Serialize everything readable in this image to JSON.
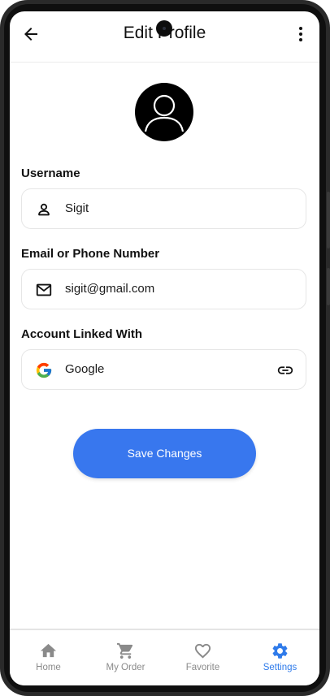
{
  "appbar": {
    "title": "Edit Profile",
    "back_icon": "arrow-back-icon",
    "more_icon": "more-vert-icon"
  },
  "avatar": {
    "icon": "person-icon"
  },
  "form": {
    "username": {
      "label": "Username",
      "value": "Sigit",
      "icon": "person-outline-icon"
    },
    "contact": {
      "label": "Email or Phone Number",
      "value": "sigit@gmail.com",
      "icon": "mail-outline-icon"
    },
    "linked": {
      "label": "Account Linked With",
      "value": "Google",
      "icon": "google-icon",
      "action_icon": "link-icon"
    }
  },
  "save_button": {
    "label": "Save Changes"
  },
  "bottom_nav": {
    "items": [
      {
        "label": "Home",
        "icon": "home-icon",
        "active": false
      },
      {
        "label": "My Order",
        "icon": "cart-icon",
        "active": false
      },
      {
        "label": "Favorite",
        "icon": "heart-outline-icon",
        "active": false
      },
      {
        "label": "Settings",
        "icon": "gear-icon",
        "active": true
      }
    ]
  },
  "colors": {
    "accent": "#3877EE",
    "active_nav": "#2F7BEA",
    "inactive_nav": "#8A8A8A",
    "text": "#111111"
  }
}
